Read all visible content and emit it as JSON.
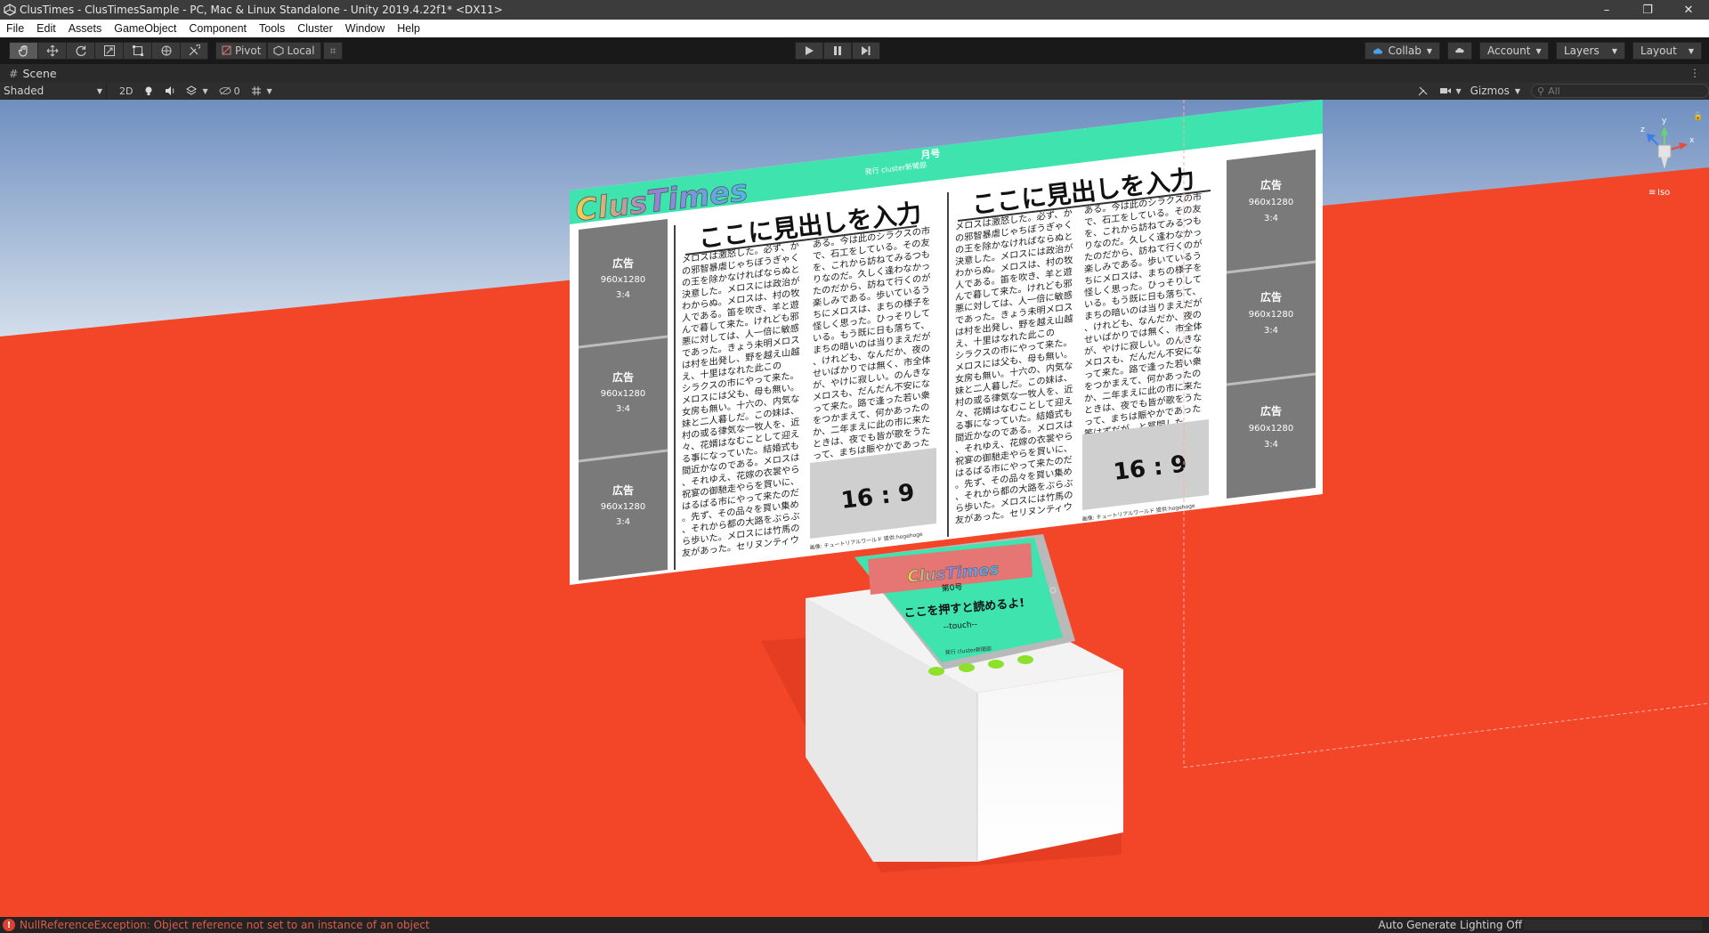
{
  "window": {
    "title": "ClusTimes - ClusTimesSample - PC, Mac & Linux Standalone - Unity 2019.4.22f1* <DX11>",
    "minimize": "–",
    "restore": "❐",
    "close": "✕"
  },
  "menu": [
    "File",
    "Edit",
    "Assets",
    "GameObject",
    "Component",
    "Tools",
    "Cluster",
    "Window",
    "Help"
  ],
  "toolbar": {
    "pivot_label": "Pivot",
    "local_label": "Local",
    "collab_label": "Collab",
    "account_label": "Account",
    "layers_label": "Layers",
    "layout_label": "Layout"
  },
  "scene_tab": {
    "label": "Scene",
    "more": "⋮"
  },
  "scene_toolbar": {
    "shading": "Shaded",
    "mode_2d": "2D",
    "hidden_count": "0",
    "gizmos_label": "Gizmos",
    "search_placeholder": "All"
  },
  "gizmo": {
    "x": "x",
    "y": "y",
    "z": "z",
    "projection": "Iso"
  },
  "newspaper": {
    "logo": "ClusTimes",
    "issue": "月号",
    "publisher": "発行 cluster新聞部",
    "headline": "ここに見出しを入力",
    "ad_title": "広告",
    "ad_size": "960x1280",
    "ad_ratio": "3:4",
    "image_ratio": "16 : 9",
    "image_caption": "画像: チュートリアルワールド 提供:hogehoge",
    "body_lines": [
      "メロスは激怒した。必ず、か",
      "の邪智暴虐じゃちぼうぎゃく",
      "の王を除かなければならぬと",
      "決意した。メロスには政治が",
      "わからぬ。メロスは、村の牧",
      "人である。笛を吹き、羊と遊",
      "んで暮して来た。けれども邪",
      "悪に対しては、人一倍に敏感",
      "であった。きょう未明メロス",
      "は村を出発し、野を越え山越",
      "え、十里はなれた此この",
      "シラクスの市にやって来た。",
      "メロスには父も、母も無い。",
      "女房も無い。十六の、内気な",
      "妹と二人暮しだ。この妹は、",
      "村の或る律気な一牧人を、近",
      "々、花婿はなむことして迎え",
      "る事になっていた。結婚式も",
      "間近かなのである。メロスは",
      "、それゆえ、花嫁の衣裳やら",
      "祝宴の御馳走やらを買いに、",
      "はるばる市にやって来たのだ",
      "。先ず、その品々を買い集め",
      "、それから都の大路をぶらぶ",
      "ら歩いた。メロスには竹馬の",
      "友があった。セリヌンティウ"
    ],
    "body_lines_b": [
      "ある。今は此のシラクスの市",
      "で、石工をしている。その友",
      "を、これから訪ねてみるつも",
      "りなのだ。久しく逢わなかっ",
      "たのだから、訪ねて行くのが",
      "楽しみである。歩いているう",
      "ちにメロスは、まちの様子を",
      "怪しく思った。ひっそりして",
      "いる。もう既に日も落ちて、",
      "まちの暗いのは当りまえだが",
      "、けれども、なんだか、夜の",
      "せいばかりでは無く、市全体",
      "が、やけに寂しい。のんきな",
      "メロスも、だんだん不安にな",
      "って来た。路で逢った若い衆",
      "をつかまえて、何かあったの",
      "か、二年まえに此の市に来た",
      "ときは、夜でも皆が歌をうた",
      "って、まちは賑やかであった",
      "筈はずだが、と質問した。"
    ]
  },
  "kiosk": {
    "logo": "ClusTimes",
    "issue": "第0号",
    "cta": "ここを押すと読めるよ!",
    "touch": "--touch--",
    "footer": "発行 cluster新聞部"
  },
  "status": {
    "error_icon": "!",
    "error": "NullReferenceException: Object reference not set to an instance of an object",
    "lighting": "Auto Generate Lighting Off"
  },
  "colors": {
    "floor": "#f34628",
    "sky_top": "#6e8fc2",
    "sky_bottom": "#d6e2ef",
    "accent_teal": "#3ee3ad",
    "ad_grey": "#7a7a7a",
    "error_red": "#e05a4a"
  }
}
